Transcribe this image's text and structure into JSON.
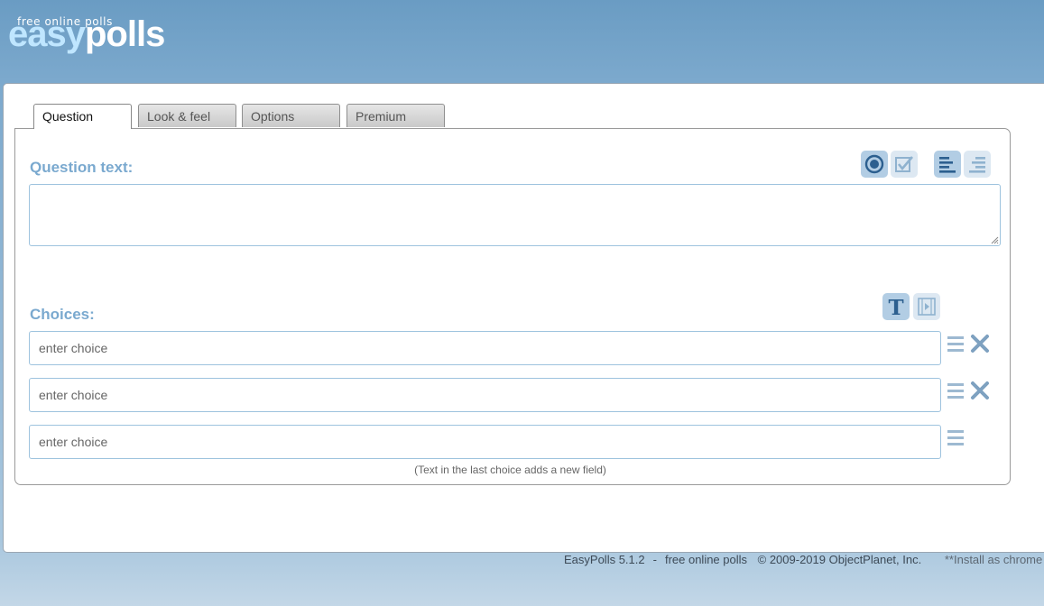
{
  "header": {
    "tagline": "free online polls",
    "logo_part1": "easy",
    "logo_part2": "polls"
  },
  "tabs": [
    {
      "label": "Question",
      "active": true
    },
    {
      "label": "Look & feel",
      "active": false
    },
    {
      "label": "Options",
      "active": false
    },
    {
      "label": "Premium",
      "active": false
    }
  ],
  "question": {
    "label": "Question text:",
    "value": "",
    "tools": [
      {
        "icon": "radio-single-choice-icon",
        "selected": true
      },
      {
        "icon": "checkbox-multiple-choice-icon",
        "selected": false
      },
      {
        "icon": "align-left-icon",
        "selected": true
      },
      {
        "icon": "align-right-icon",
        "selected": false
      }
    ]
  },
  "choices": {
    "label": "Choices:",
    "tools": [
      {
        "icon": "text-choice-icon",
        "selected": true
      },
      {
        "icon": "media-choice-icon",
        "selected": false
      }
    ],
    "items": [
      {
        "placeholder": "enter choice",
        "value": "",
        "removable": true
      },
      {
        "placeholder": "enter choice",
        "value": "",
        "removable": true
      },
      {
        "placeholder": "enter choice",
        "value": "",
        "removable": false
      }
    ],
    "hint": "(Text in the last choice adds a new field)"
  },
  "footer": {
    "product": "EasyPolls 5.1.2",
    "separator": "-",
    "tagline": "free online polls",
    "copyright": "© 2009-2019 ObjectPlanet, Inc.",
    "promo": "**Install as chrome v"
  },
  "colors": {
    "accent": "#7aa9cf",
    "icon": "#2c5f8f",
    "icon_muted": "#8fb2cf",
    "border": "#9ec3de"
  }
}
